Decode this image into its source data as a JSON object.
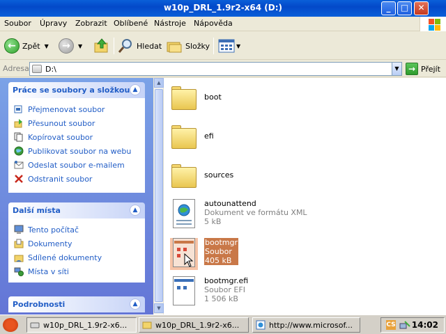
{
  "window": {
    "title": "w10p_DRL_1.9r2-x64 (D:)",
    "minimize": "_",
    "maximize": "□",
    "close": "✕"
  },
  "menu": [
    "Soubor",
    "Úpravy",
    "Zobrazit",
    "Oblíbené",
    "Nástroje",
    "Nápověda"
  ],
  "toolbar": {
    "back_label": "Zpět",
    "search_label": "Hledat",
    "folders_label": "Složky"
  },
  "address": {
    "label": "Adresa",
    "value": "D:\\",
    "go_label": "Přejít"
  },
  "tasks_panel": {
    "title": "Práce se soubory a složkou",
    "items": [
      "Přejmenovat soubor",
      "Přesunout soubor",
      "Kopírovat soubor",
      "Publikovat soubor na webu",
      "Odeslat soubor e-mailem",
      "Odstranit soubor"
    ]
  },
  "places_panel": {
    "title": "Další místa",
    "items": [
      "Tento počítač",
      "Dokumenty",
      "Sdílené dokumenty",
      "Místa v síti"
    ]
  },
  "details_panel": {
    "title": "Podrobnosti"
  },
  "files": [
    {
      "name": "boot"
    },
    {
      "name": "efi"
    },
    {
      "name": "sources"
    },
    {
      "name": "autounattend",
      "type": "Dokument ve formátu XML",
      "size": "5 kB"
    },
    {
      "name": "bootmgr",
      "type": "Soubor",
      "size": "405 kB"
    },
    {
      "name": "bootmgr.efi",
      "type": "Soubor EFI",
      "size": "1 506 kB"
    }
  ],
  "taskbar": {
    "buttons": [
      "w10p_DRL_1.9r2-x6...",
      "w10p_DRL_1.9r2-x6...",
      "http://www.microsof..."
    ],
    "tray_text": "CS",
    "clock": "14:02"
  }
}
